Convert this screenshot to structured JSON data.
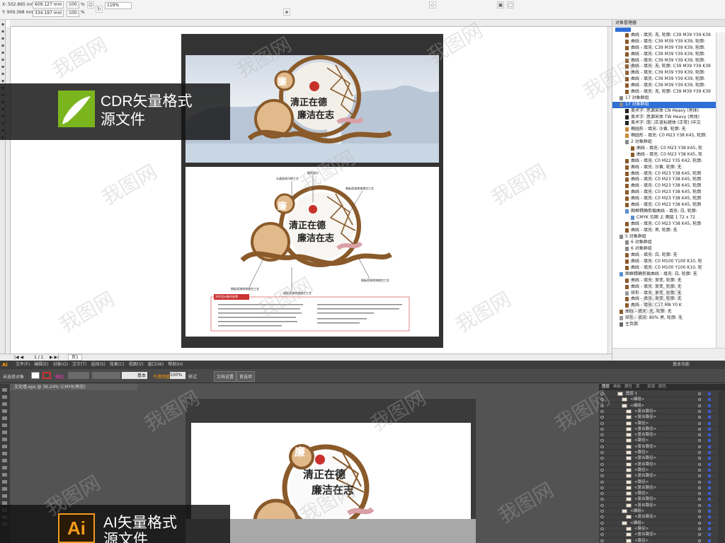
{
  "cdr": {
    "coords": {
      "x": "X: 502.865 mm",
      "y": "Y: 909.368 mm",
      "w": "609.127 mm",
      "h": "334.197 mm",
      "sx": "100.0",
      "sy": "100.0",
      "pct": "%"
    },
    "zoom": "119%",
    "toolbox_icons": [
      "pointer-icon",
      "shape-icon",
      "crop-icon",
      "zoom-icon",
      "freehand-icon",
      "smart-fill-icon",
      "rect-icon",
      "ellipse-icon",
      "polygon-icon",
      "text-icon",
      "table-icon",
      "dimension-icon",
      "connector-icon",
      "effects-icon",
      "eyedropper-icon",
      "fill-icon",
      "outline-icon"
    ],
    "status": {
      "page": "1 / 1",
      "page_tab": "页1"
    },
    "obj_manager": {
      "title": "对象管理器",
      "rows": [
        {
          "indent": 1,
          "type": "curve",
          "text": "曲线 - 填充: 无, 轮廓: C39 M39 Y39 K39"
        },
        {
          "indent": 1,
          "type": "curve",
          "text": "曲线 - 填充: C39 M39 Y39 K39, 轮廓:"
        },
        {
          "indent": 1,
          "type": "curve",
          "text": "曲线 - 填充: C39 M39 Y39 K39, 轮廓:"
        },
        {
          "indent": 1,
          "type": "curve",
          "text": "曲线 - 填充: C39 M39 Y39 K39, 轮廓:"
        },
        {
          "indent": 1,
          "type": "curve",
          "text": "曲线 - 填充: C39 M39 Y39 K39, 轮廓:"
        },
        {
          "indent": 1,
          "type": "curve",
          "text": "曲线 - 填充: 无, 轮廓: C39 M39 Y39 K39"
        },
        {
          "indent": 1,
          "type": "curve",
          "text": "曲线 - 填充: C39 M39 Y39 K39, 轮廓:"
        },
        {
          "indent": 1,
          "type": "curve",
          "text": "曲线 - 填充: C39 M39 Y39 K39, 轮廓:"
        },
        {
          "indent": 1,
          "type": "curve",
          "text": "曲线 - 填充: C39 M39 Y39 K39, 轮廓:"
        },
        {
          "indent": 1,
          "type": "curve",
          "text": "曲线 - 填充: 无, 轮廓: C39 M39 Y39 K39"
        },
        {
          "indent": 0,
          "type": "group",
          "text": "17 对象群组"
        },
        {
          "indent": 0,
          "type": "group-sel",
          "text": "17 对象群组"
        },
        {
          "indent": 1,
          "type": "text",
          "text": "美术字: 思源宋体 CN Heavy (黑体)"
        },
        {
          "indent": 1,
          "type": "text",
          "text": "美术字: 思源宋体 TW Heavy (黑体)"
        },
        {
          "indent": 1,
          "type": "text",
          "text": "美术字: 庞门正道标题体 (正常) (中文"
        },
        {
          "indent": 1,
          "type": "ellipse",
          "text": "椭圆形 - 填充: 沙黄, 轮廓: 无"
        },
        {
          "indent": 1,
          "type": "ellipse",
          "text": "椭圆形 - 填充: C0 M23 Y38 K45, 轮廓:"
        },
        {
          "indent": 1,
          "type": "group",
          "text": "2 对象群组"
        },
        {
          "indent": 2,
          "type": "curve",
          "text": "曲线 - 填充: C0 M23 Y38 K45, 轮"
        },
        {
          "indent": 2,
          "type": "curve",
          "text": "曲线 - 填充: C0 M23 Y38 K45, 轮"
        },
        {
          "indent": 1,
          "type": "curve",
          "text": "曲线 - 填充: C0 M22 Y35 K42, 轮廓:"
        },
        {
          "indent": 1,
          "type": "curve",
          "text": "曲线 - 填充: 沙黄, 轮廓: 无"
        },
        {
          "indent": 1,
          "type": "curve",
          "text": "曲线 - 填充: C0 M23 Y38 K45, 轮廓"
        },
        {
          "indent": 1,
          "type": "curve",
          "text": "曲线 - 填充: C0 M23 Y38 K45, 轮廓"
        },
        {
          "indent": 1,
          "type": "curve",
          "text": "曲线 - 填充: C0 M23 Y38 K45, 轮廓"
        },
        {
          "indent": 1,
          "type": "curve",
          "text": "曲线 - 填充: C0 M23 Y38 K45, 轮廓"
        },
        {
          "indent": 1,
          "type": "curve",
          "text": "曲线 - 填充: C0 M23 Y38 K45, 轮廓"
        },
        {
          "indent": 1,
          "type": "curve",
          "text": "曲线 - 填充: C0 M23 Y38 K45, 轮廓"
        },
        {
          "indent": 1,
          "type": "bitmap",
          "text": "图框精确剪裁曲线 - 填充: 白, 轮廓:"
        },
        {
          "indent": 2,
          "type": "bitmap",
          "text": "CMYK 位图 上 图层 1 72 x 72"
        },
        {
          "indent": 1,
          "type": "curve",
          "text": "曲线 - 填充: C0 M23 Y38 K45, 轮廓"
        },
        {
          "indent": 1,
          "type": "curve",
          "text": "曲线 - 填充: 黑, 轮廓: 无"
        },
        {
          "indent": 0,
          "type": "group",
          "text": "5 对象群组"
        },
        {
          "indent": 1,
          "type": "group",
          "text": "6 对象群组"
        },
        {
          "indent": 1,
          "type": "group",
          "text": "6 对象群组"
        },
        {
          "indent": 1,
          "type": "curve",
          "text": "曲线 - 填充: 白, 轮廓: 无"
        },
        {
          "indent": 1,
          "type": "curve",
          "text": "曲线 - 填充: C0 M100 Y100 K10, 轮"
        },
        {
          "indent": 1,
          "type": "curve",
          "text": "曲线 - 填充: C0 M100 Y100 K10, 轮"
        },
        {
          "indent": 0,
          "type": "bitmap",
          "text": "图框精确剪裁曲线 - 填充: 白, 轮廓: 无"
        },
        {
          "indent": 1,
          "type": "curve",
          "text": "曲线 - 填充: 渐变, 轮廓: 无"
        },
        {
          "indent": 1,
          "type": "curve",
          "text": "曲线 - 填充: 渐变, 轮廓: 无"
        },
        {
          "indent": 1,
          "type": "rect",
          "text": "矩形 - 填充: 渐变, 轮廓: 无"
        },
        {
          "indent": 1,
          "type": "curve",
          "text": "曲线 - 填充: 渐变, 轮廓: 无"
        },
        {
          "indent": 1,
          "type": "curve",
          "text": "曲线 - 填充: C17 M8 Y0 K"
        },
        {
          "indent": 0,
          "type": "curve",
          "text": "曲线 - 填充: 无, 轮廓: 无"
        },
        {
          "indent": 0,
          "type": "rect",
          "text": "矩形 - 填充: 80% 黑, 轮廓: 无"
        },
        {
          "indent": 0,
          "type": "page",
          "text": "主页面"
        }
      ]
    }
  },
  "overlay": {
    "cdr_label_1": "CDR矢量格式",
    "cdr_label_2": "源文件",
    "ai_label_1": "AI矢量格式",
    "ai_label_2": "源文件",
    "watermark": "我图网"
  },
  "design": {
    "badge": "廉",
    "title_1": "清正在德",
    "title_2": "廉洁在志",
    "annotations": [
      "水晶贴纸印刷工艺",
      "雕刻部分",
      "钢板喷漆烤漆镂空工艺",
      "钢板喷漆烤漆镂空工艺",
      "钢板喷漆烤漆镂空工艺",
      "钢板喷漆烤漆镂空工艺"
    ],
    "notes_header": "文件设计制作说明"
  },
  "ai": {
    "logo": "Ai",
    "menu": [
      "文件(F)",
      "编辑(E)",
      "对象(O)",
      "文字(T)",
      "选择(S)",
      "效果(C)",
      "视图(V)",
      "窗口(W)",
      "帮助(H)"
    ],
    "workspace": "基本功能",
    "ctrl": {
      "selection": "未选择对象",
      "stroke_label": "描边",
      "stroke_width": "基本",
      "opacity_label": "不透明度",
      "opacity": "100%",
      "style_label": "样式",
      "doc_setup": "文档设置",
      "prefs": "首选项"
    },
    "doc_tab": "文化墙.eps @ 36.24% (CMYK/预览)",
    "panel_tabs": [
      "图层",
      "画板",
      "属性",
      "库",
      "资源",
      "颜色"
    ],
    "layers": [
      {
        "name": "图层 1",
        "lvl": 0
      },
      {
        "name": "<编组>",
        "lvl": 1
      },
      {
        "name": "<编组>",
        "lvl": 1
      },
      {
        "name": "<复合路径>",
        "lvl": 2
      },
      {
        "name": "<复合路径>",
        "lvl": 2
      },
      {
        "name": "<路径>",
        "lvl": 2
      },
      {
        "name": "<复合路径>",
        "lvl": 2
      },
      {
        "name": "<复合路径>",
        "lvl": 2
      },
      {
        "name": "<路径>",
        "lvl": 2
      },
      {
        "name": "<复合路径>",
        "lvl": 2
      },
      {
        "name": "<路径>",
        "lvl": 2
      },
      {
        "name": "<复合路径>",
        "lvl": 2
      },
      {
        "name": "<复合路径>",
        "lvl": 2
      },
      {
        "name": "<路径>",
        "lvl": 2
      },
      {
        "name": "<复合路径>",
        "lvl": 2
      },
      {
        "name": "<路径>",
        "lvl": 2
      },
      {
        "name": "<复合路径>",
        "lvl": 2
      },
      {
        "name": "<路径>",
        "lvl": 2
      },
      {
        "name": "<复合路径>",
        "lvl": 2
      },
      {
        "name": "<复合路径>",
        "lvl": 2
      },
      {
        "name": "<编组>",
        "lvl": 1
      },
      {
        "name": "<复合路径>",
        "lvl": 2
      },
      {
        "name": "<编组>",
        "lvl": 1
      },
      {
        "name": "<路径>",
        "lvl": 2
      },
      {
        "name": "<复合路径>",
        "lvl": 2
      },
      {
        "name": "<路径>",
        "lvl": 2
      }
    ]
  },
  "colors": {
    "brown": "#8a5a2b",
    "tan": "#e2b98a",
    "selection": "#2f6fd6",
    "ai_bg": "#535353"
  }
}
